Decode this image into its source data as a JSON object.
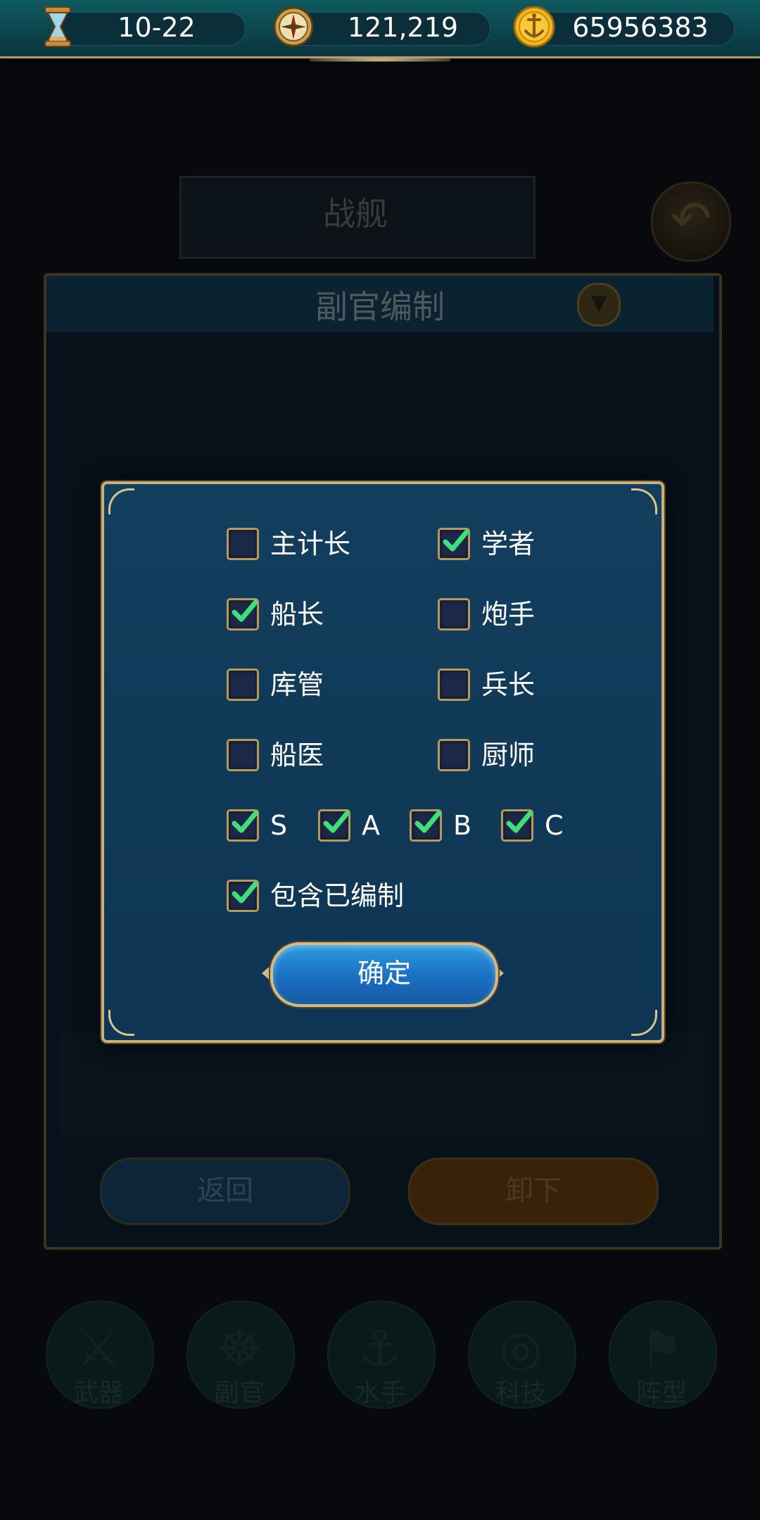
{
  "resources": {
    "time": {
      "icon": "hourglass-icon",
      "value": "10-22"
    },
    "compass": {
      "icon": "compass-icon",
      "value": "121,219"
    },
    "gold": {
      "icon": "gold-coin-icon",
      "value": "65956383"
    }
  },
  "background": {
    "banner_title": "战舰",
    "back_icon": "return-arrow-icon",
    "panel_title": "副官编制",
    "filter_icon": "filter-funnel-icon",
    "back_button": "返回",
    "unload_button": "卸下",
    "nav": [
      {
        "label": "武器",
        "icon": "sword-icon"
      },
      {
        "label": "副官",
        "icon": "ship-wheel-icon"
      },
      {
        "label": "水手",
        "icon": "hook-icon"
      },
      {
        "label": "科技",
        "icon": "compass-tech-icon"
      },
      {
        "label": "阵型",
        "icon": "flag-icon"
      }
    ]
  },
  "filter_modal": {
    "roles": [
      {
        "label": "主计长",
        "checked": false
      },
      {
        "label": "学者",
        "checked": true
      },
      {
        "label": "船长",
        "checked": true
      },
      {
        "label": "炮手",
        "checked": false
      },
      {
        "label": "库管",
        "checked": false
      },
      {
        "label": "兵长",
        "checked": false
      },
      {
        "label": "船医",
        "checked": false
      },
      {
        "label": "厨师",
        "checked": false
      }
    ],
    "grades": [
      {
        "label": "S",
        "checked": true
      },
      {
        "label": "A",
        "checked": true
      },
      {
        "label": "B",
        "checked": true
      },
      {
        "label": "C",
        "checked": true
      }
    ],
    "include_assigned": {
      "label": "包含已编制",
      "checked": true
    },
    "confirm_label": "确定"
  },
  "colors": {
    "modal_bg": "#133e5d",
    "gold_border": "#c9b07a",
    "check_green": "#3fe07a",
    "confirm_blue": "#2b9ae0"
  }
}
